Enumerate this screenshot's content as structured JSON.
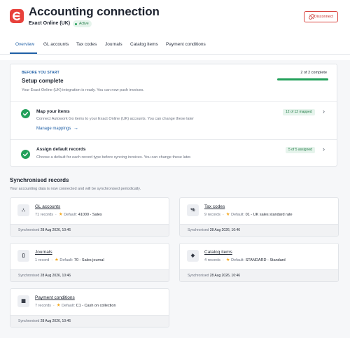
{
  "header": {
    "title": "Accounting connection",
    "subtitle": "Exact Online (UK)",
    "status": "Active",
    "disconnect_label": "Disconnect"
  },
  "tabs": [
    {
      "label": "Overview",
      "active": true
    },
    {
      "label": "GL accounts"
    },
    {
      "label": "Tax codes"
    },
    {
      "label": "Journals"
    },
    {
      "label": "Catalog items"
    },
    {
      "label": "Payment conditions"
    }
  ],
  "setup": {
    "eyebrow": "BEFORE YOU START",
    "title": "Setup complete",
    "description": "Your Exact Online (UK) integration is ready. You can now push invoices.",
    "progress_label": "2 of 2 complete",
    "progress_fraction": 1.0,
    "steps": [
      {
        "title": "Map your items",
        "description": "Connect Autowork Go items to your Exact Online (UK) accounts. You can change these later",
        "link": "Manage mappings",
        "badge": "12 of 12 mapped"
      },
      {
        "title": "Assign default records",
        "description": "Choose a default for each record type before syncing invoices. You can change these later.",
        "badge": "5 of 5 assigned"
      }
    ]
  },
  "synced": {
    "title": "Synchronised records",
    "description": "Your accounting data is now connected and will be synchronised periodically.",
    "sync_prefix": "Synchronised",
    "default_prefix": "Default:",
    "records": [
      {
        "name": "GL accounts",
        "count": "71 records",
        "default": "41000 - Sales",
        "synced": "28 Aug 2026, 10:46",
        "icon": "hierarchy-icon",
        "glyph": "⛬"
      },
      {
        "name": "Tax codes",
        "count": "9 records",
        "default": "01 - UK sales standard rate",
        "synced": "28 Aug 2026, 10:46",
        "icon": "percent-icon",
        "glyph": "%"
      },
      {
        "name": "Journals",
        "count": "1 record",
        "default": "70 - Sales journal",
        "synced": "28 Aug 2026, 10:46",
        "icon": "book-icon",
        "glyph": "▯"
      },
      {
        "name": "Catalog items",
        "count": "4 records",
        "default": "STANDARD - Standard",
        "synced": "28 Aug 2026, 10:46",
        "icon": "box-icon",
        "glyph": "◈"
      },
      {
        "name": "Payment conditions",
        "count": "7 records",
        "default": "C1 - Cash on collection",
        "synced": "28 Aug 2026, 10:46",
        "icon": "calendar-icon",
        "glyph": "▦"
      }
    ]
  },
  "colors": {
    "brand": "#e8413b",
    "accent": "#1f5fa6",
    "success": "#22a05a",
    "danger": "#d9443f",
    "star": "#f3a81f"
  }
}
